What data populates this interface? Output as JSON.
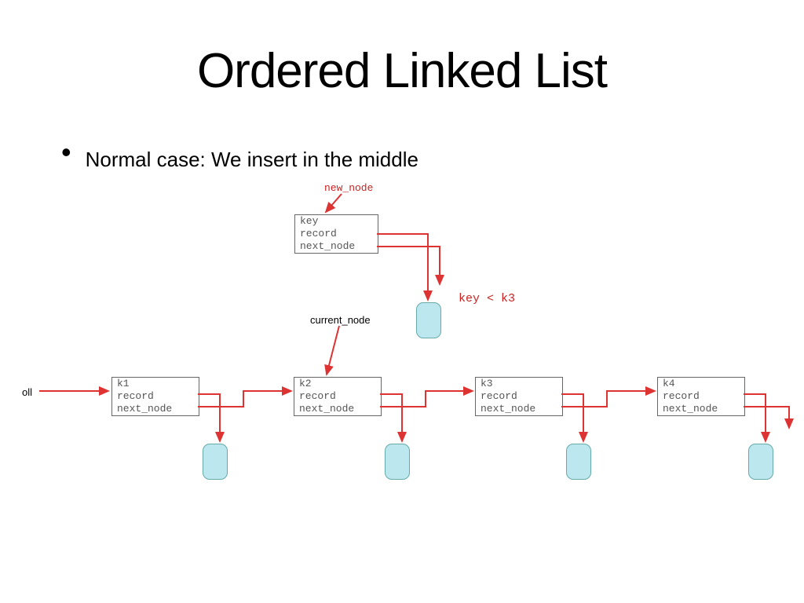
{
  "title": "Ordered Linked List",
  "bullet": "Normal case: We insert in the middle",
  "labels": {
    "oll": "oll",
    "new_node": "new_node",
    "current_node": "current_node",
    "cond": "key < k3"
  },
  "new_node": {
    "l1": "key",
    "l2": "record",
    "l3": "next_node"
  },
  "nodes": [
    {
      "l1": "k1",
      "l2": "record",
      "l3": "next_node"
    },
    {
      "l1": "k2",
      "l2": "record",
      "l3": "next_node"
    },
    {
      "l1": "k3",
      "l2": "record",
      "l3": "next_node"
    },
    {
      "l1": "k4",
      "l2": "record",
      "l3": "next_node"
    }
  ]
}
